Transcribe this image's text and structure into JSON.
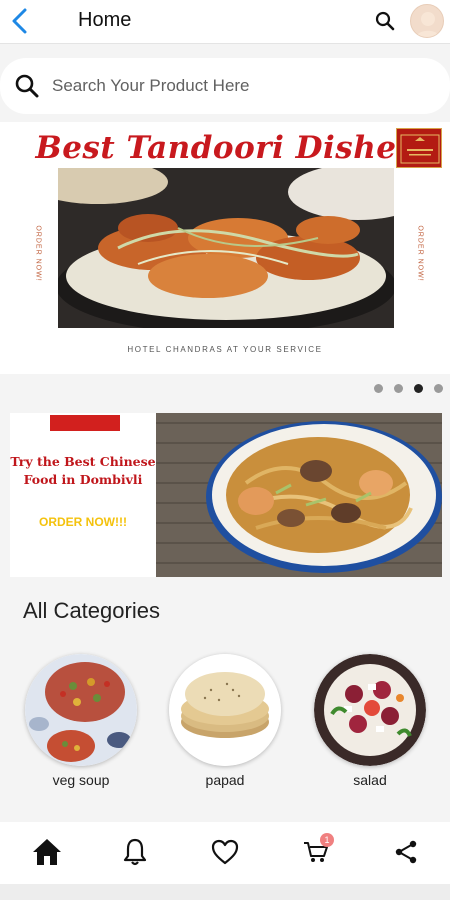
{
  "appbar": {
    "title": "Home",
    "icons": [
      "back-arrow-icon",
      "search-icon",
      "avatar"
    ],
    "accent_color": "#1e88e5"
  },
  "search": {
    "placeholder": "Search Your Product Here"
  },
  "banner_primary": {
    "headline": "Best Tandoori Dishes",
    "side_text_left": "ORDER NOW!",
    "side_text_right": "ORDER NOW!",
    "footer": "HOTEL CHANDRAS AT YOUR SERVICE",
    "headline_color": "#c8191e"
  },
  "carousel": {
    "dot_count": 4,
    "active_index": 2
  },
  "banner_secondary": {
    "headline": "Try the Best Chinese Food in Dombivli",
    "cta": "ORDER NOW!!!",
    "headline_color": "#c0161b",
    "cta_color": "#f4c20d"
  },
  "categories": {
    "title": "All Categories",
    "items": [
      {
        "label": "veg soup"
      },
      {
        "label": "papad"
      },
      {
        "label": "salad"
      }
    ]
  },
  "bottom_nav": {
    "items": [
      "home-icon",
      "bell-icon",
      "heart-icon",
      "cart-icon",
      "share-icon"
    ],
    "cart_badge": "1",
    "badge_color": "#f08080"
  }
}
